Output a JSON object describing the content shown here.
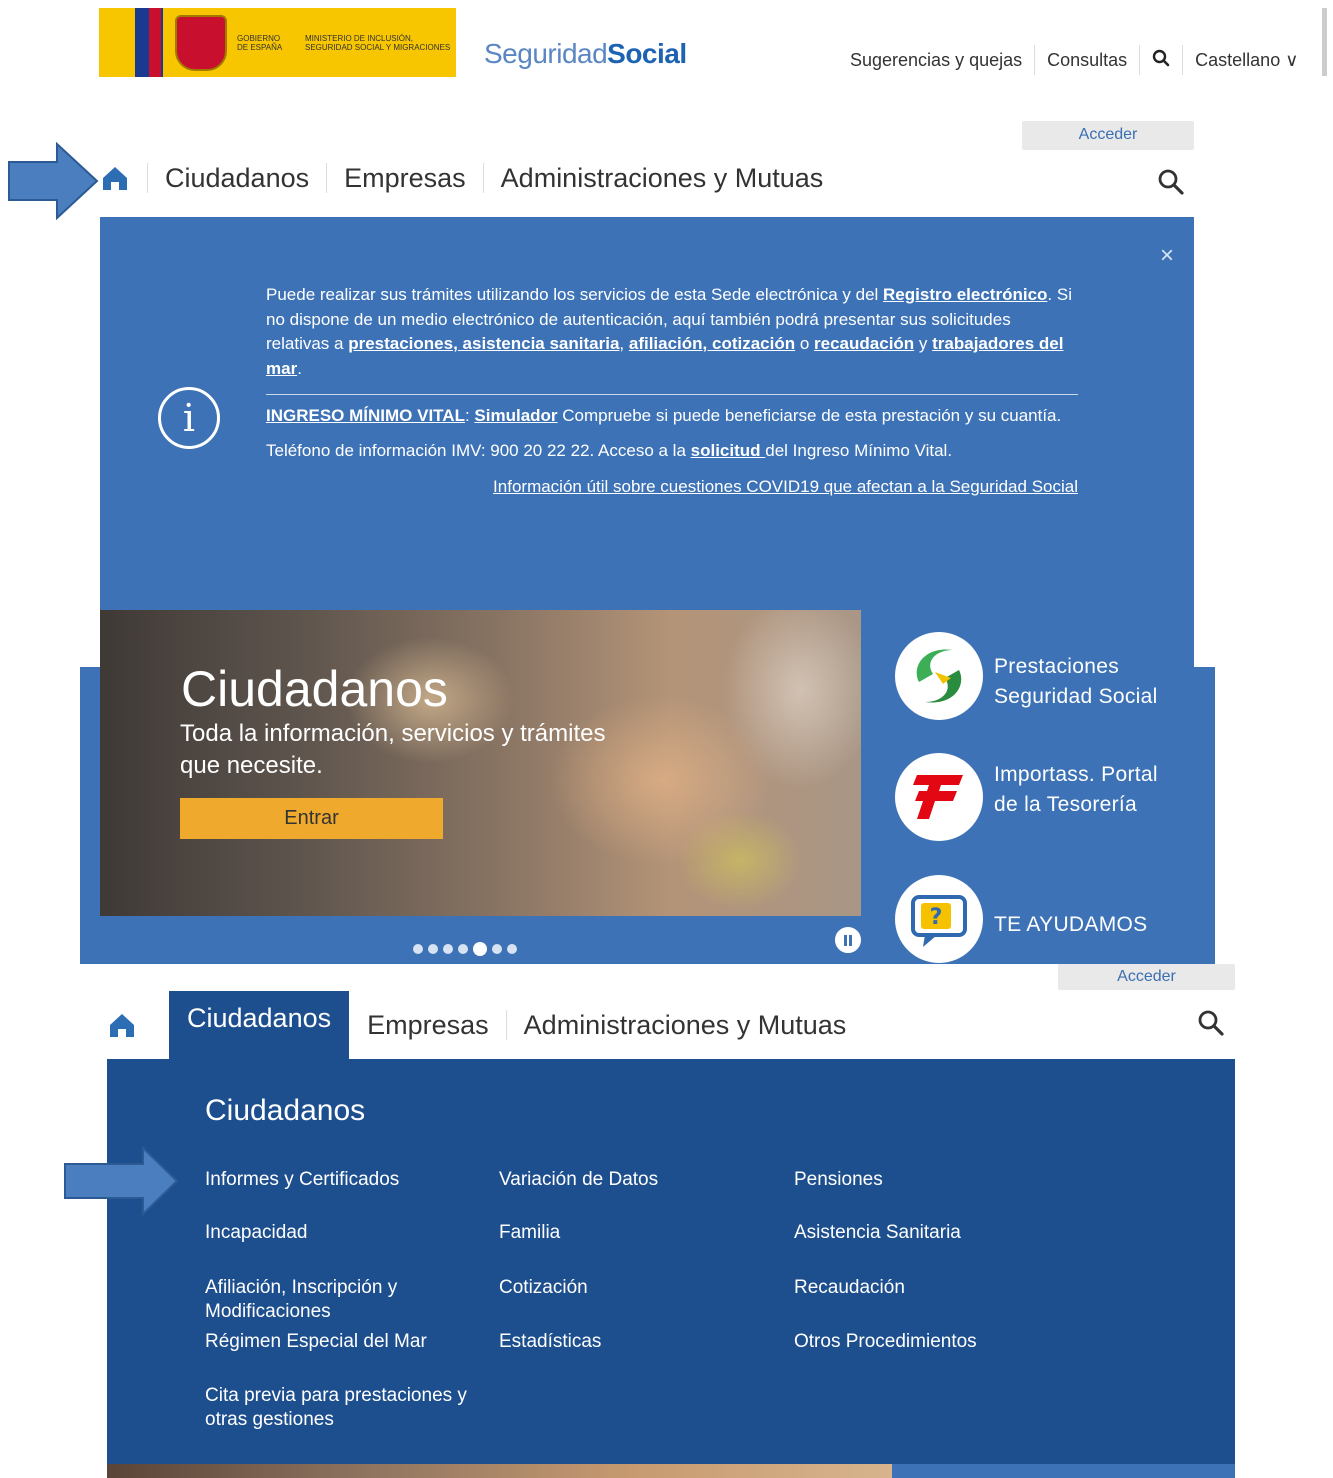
{
  "header": {
    "gov_logo_gobierno": "GOBIERNO DE ESPAÑA",
    "gov_logo_ministerio": "MINISTERIO DE INCLUSIÓN, SEGURIDAD SOCIAL Y MIGRACIONES",
    "site_logo_light": "Seguridad",
    "site_logo_bold": "Social",
    "top_links": [
      "Sugerencias y quejas",
      "Consultas"
    ],
    "search_icon": "search-icon",
    "language": "Castellano ∨"
  },
  "nav_primary": {
    "acceder": "Acceder",
    "home_icon": "home-icon",
    "items": [
      "Ciudadanos",
      "Empresas",
      "Administraciones y Mutuas"
    ],
    "search_icon": "search-icon"
  },
  "banner": {
    "close_label": "×",
    "info_icon_glyph": "i",
    "p1_a": "Puede realizar sus trámites utilizando los servicios de esta Sede electrónica y del ",
    "p1_link1": "Registro electrónico",
    "p1_b": ". Si no dispone de un medio electrónico de autenticación, aquí también podrá presentar sus solicitudes relativas a ",
    "p1_link2": "prestaciones, asistencia sanitaria",
    "p1_c": ", ",
    "p1_link3": "afiliación, cotización",
    "p1_d": " o ",
    "p1_link4": "recaudación",
    "p1_e": " y ",
    "p1_link5": "trabajadores del mar",
    "p1_f": ".",
    "imv_link": "INGRESO MÍNIMO VITAL",
    "imv_colon": ": ",
    "simulador_link": "Simulador",
    "imv_text": " Compruebe si puede beneficiarse de esta prestación y su cuantía.",
    "phone_a": "Teléfono de información IMV: 900 20 22 22. Acceso a la ",
    "solicitud_link": "solicitud ",
    "phone_b": "del Ingreso Mínimo Vital.",
    "covid_link": "Información útil sobre cuestiones COVID19 que afectan a la Seguridad Social"
  },
  "hero": {
    "title": "Ciudadanos",
    "subtitle": "Toda la información, servicios y trámites que necesite.",
    "button": "Entrar",
    "slide_count": 7,
    "active_slide": 5
  },
  "quick_links": [
    {
      "label": "Prestaciones Seguridad Social",
      "icon": "prestaciones-logo-icon"
    },
    {
      "label": "Importass. Portal de la Tesorería",
      "icon": "importass-logo-icon"
    },
    {
      "label": "TE AYUDAMOS",
      "icon": "help-question-icon"
    }
  ],
  "nav_secondary": {
    "acceder": "Acceder",
    "home_icon": "home-icon",
    "active_tab": "Ciudadanos",
    "items": [
      "Empresas",
      "Administraciones y Mutuas"
    ],
    "search_icon": "search-icon"
  },
  "mega_menu": {
    "title": "Ciudadanos",
    "columns": [
      [
        "Informes y Certificados",
        "Incapacidad",
        "Afiliación, Inscripción y Modificaciones",
        "Régimen Especial del Mar",
        "Cita previa para prestaciones y otras gestiones"
      ],
      [
        "Variación de Datos",
        "Familia",
        "Cotización",
        "Estadísticas"
      ],
      [
        "Pensiones",
        "Asistencia Sanitaria",
        "Recaudación",
        "Otros Procedimientos"
      ]
    ]
  },
  "colors": {
    "banner_blue": "#3d73b6",
    "menu_blue": "#1d4f8e",
    "button_yellow": "#efaa2d",
    "arrow_blue": "#4a7ebf"
  }
}
